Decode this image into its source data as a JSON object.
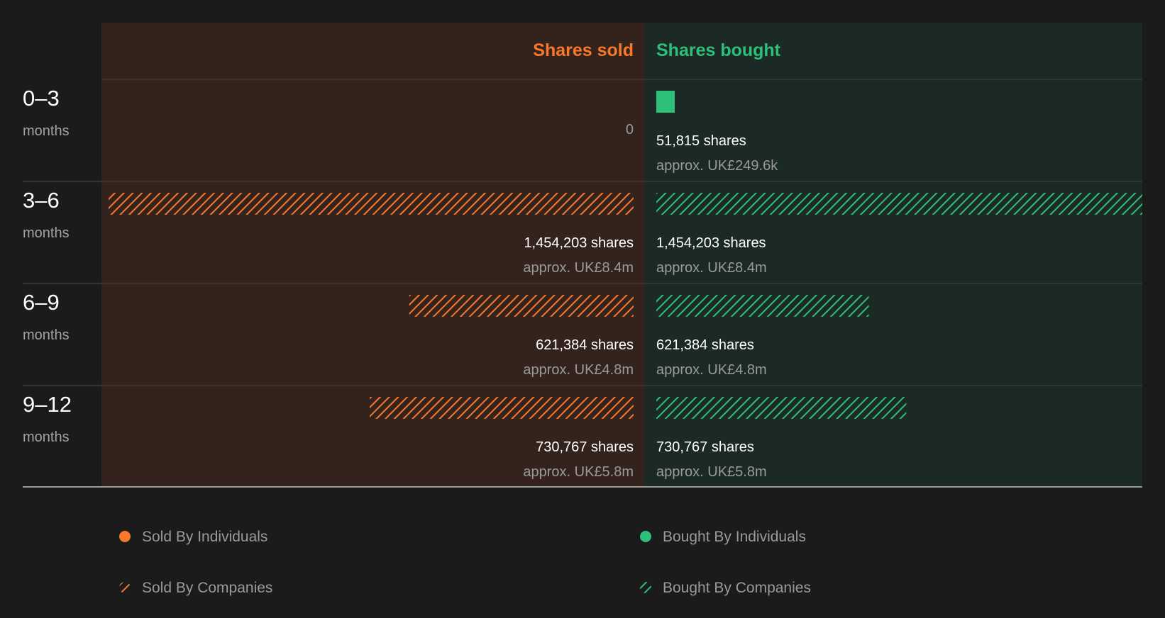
{
  "colors": {
    "sold": "#f9782a",
    "bought": "#2ebf78"
  },
  "chart_data": {
    "type": "bar",
    "orientation": "horizontal-diverging",
    "headers": {
      "sold": "Shares sold",
      "bought": "Shares bought"
    },
    "rows": [
      {
        "range": "0–3",
        "unit": "months",
        "sold": {
          "value": 0,
          "label": "0",
          "companies": true
        },
        "bought": {
          "value": 51815,
          "label": "51,815 shares",
          "approx": "approx. UK£249.6k",
          "companies": false
        }
      },
      {
        "range": "3–6",
        "unit": "months",
        "sold": {
          "value": 1454203,
          "label": "1,454,203 shares",
          "approx": "approx. UK£8.4m",
          "companies": true
        },
        "bought": {
          "value": 1454203,
          "label": "1,454,203 shares",
          "approx": "approx. UK£8.4m",
          "companies": true
        }
      },
      {
        "range": "6–9",
        "unit": "months",
        "sold": {
          "value": 621384,
          "label": "621,384 shares",
          "approx": "approx. UK£4.8m",
          "companies": true
        },
        "bought": {
          "value": 621384,
          "label": "621,384 shares",
          "approx": "approx. UK£4.8m",
          "companies": true
        }
      },
      {
        "range": "9–12",
        "unit": "months",
        "sold": {
          "value": 730767,
          "label": "730,767 shares",
          "approx": "approx. UK£5.8m",
          "companies": true
        },
        "bought": {
          "value": 730767,
          "label": "730,767 shares",
          "approx": "approx. UK£5.8m",
          "companies": true
        }
      }
    ],
    "legend": [
      {
        "label": "Sold By Individuals",
        "side": "sold",
        "style": "solid"
      },
      {
        "label": "Sold By Companies",
        "side": "sold",
        "style": "hatched"
      },
      {
        "label": "Bought By Individuals",
        "side": "bought",
        "style": "solid"
      },
      {
        "label": "Bought By Companies",
        "side": "bought",
        "style": "hatched"
      }
    ]
  }
}
